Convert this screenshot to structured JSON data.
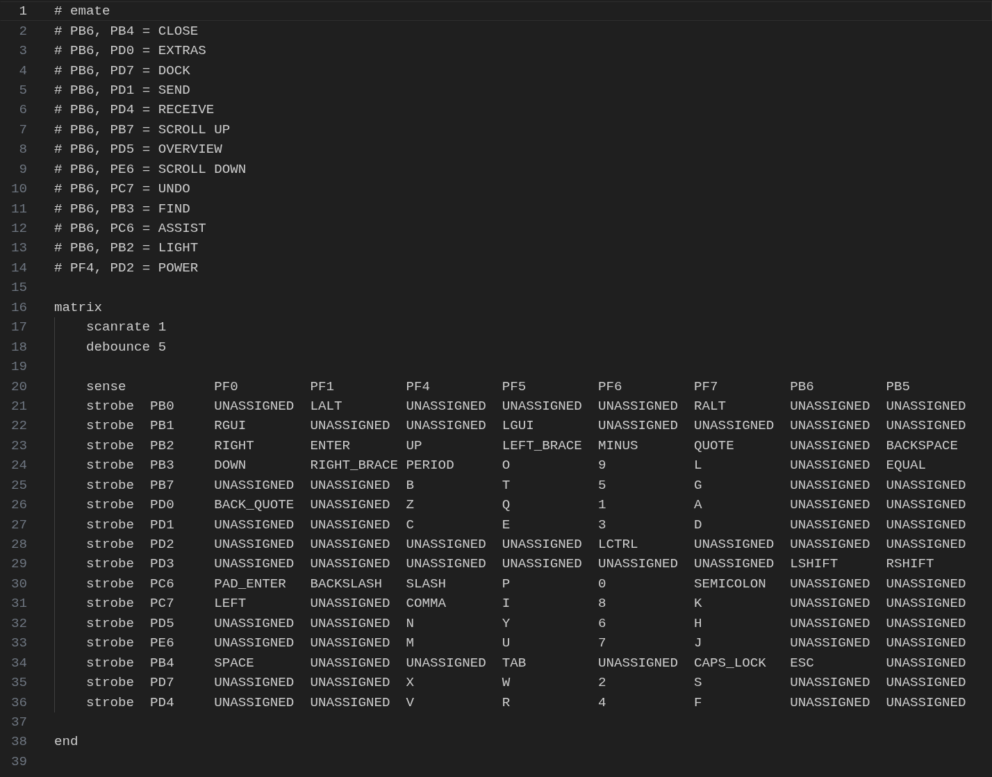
{
  "editor": {
    "lines": [
      {
        "number": "1",
        "text": "# emate",
        "current": true
      },
      {
        "number": "2",
        "text": "# PB6, PB4 = CLOSE",
        "current": false
      },
      {
        "number": "3",
        "text": "# PB6, PD0 = EXTRAS",
        "current": false
      },
      {
        "number": "4",
        "text": "# PB6, PD7 = DOCK",
        "current": false
      },
      {
        "number": "5",
        "text": "# PB6, PD1 = SEND",
        "current": false
      },
      {
        "number": "6",
        "text": "# PB6, PD4 = RECEIVE",
        "current": false
      },
      {
        "number": "7",
        "text": "# PB6, PB7 = SCROLL UP",
        "current": false
      },
      {
        "number": "8",
        "text": "# PB6, PD5 = OVERVIEW",
        "current": false
      },
      {
        "number": "9",
        "text": "# PB6, PE6 = SCROLL DOWN",
        "current": false
      },
      {
        "number": "10",
        "text": "# PB6, PC7 = UNDO",
        "current": false
      },
      {
        "number": "11",
        "text": "# PB6, PB3 = FIND",
        "current": false
      },
      {
        "number": "12",
        "text": "# PB6, PC6 = ASSIST",
        "current": false
      },
      {
        "number": "13",
        "text": "# PB6, PB2 = LIGHT",
        "current": false
      },
      {
        "number": "14",
        "text": "# PF4, PD2 = POWER",
        "current": false
      },
      {
        "number": "15",
        "current": false
      },
      {
        "number": "16",
        "text": "matrix",
        "current": false,
        "children": [
          {
            "number": "17",
            "text": "scanrate 1",
            "current": false
          },
          {
            "number": "18",
            "text": "debounce 5",
            "current": false
          },
          {
            "number": "19",
            "current": false
          },
          {
            "number": "20",
            "kind": "header",
            "cells": [
              "sense",
              "PF0",
              "PF1",
              "PF4",
              "PF5",
              "PF6",
              "PF7",
              "PB6",
              "PB5"
            ],
            "current": false
          },
          {
            "number": "21",
            "kind": "row",
            "cells": [
              "strobe",
              "PB0",
              "UNASSIGNED",
              "LALT",
              "UNASSIGNED",
              "UNASSIGNED",
              "UNASSIGNED",
              "RALT",
              "UNASSIGNED",
              "UNASSIGNED"
            ],
            "current": false
          },
          {
            "number": "22",
            "kind": "row",
            "cells": [
              "strobe",
              "PB1",
              "RGUI",
              "UNASSIGNED",
              "UNASSIGNED",
              "LGUI",
              "UNASSIGNED",
              "UNASSIGNED",
              "UNASSIGNED",
              "UNASSIGNED"
            ],
            "current": false
          },
          {
            "number": "23",
            "kind": "row",
            "cells": [
              "strobe",
              "PB2",
              "RIGHT",
              "ENTER",
              "UP",
              "LEFT_BRACE",
              "MINUS",
              "QUOTE",
              "UNASSIGNED",
              "BACKSPACE"
            ],
            "current": false
          },
          {
            "number": "24",
            "kind": "row",
            "cells": [
              "strobe",
              "PB3",
              "DOWN",
              "RIGHT_BRACE",
              "PERIOD",
              "O",
              "9",
              "L",
              "UNASSIGNED",
              "EQUAL"
            ],
            "current": false
          },
          {
            "number": "25",
            "kind": "row",
            "cells": [
              "strobe",
              "PB7",
              "UNASSIGNED",
              "UNASSIGNED",
              "B",
              "T",
              "5",
              "G",
              "UNASSIGNED",
              "UNASSIGNED"
            ],
            "current": false
          },
          {
            "number": "26",
            "kind": "row",
            "cells": [
              "strobe",
              "PD0",
              "BACK_QUOTE",
              "UNASSIGNED",
              "Z",
              "Q",
              "1",
              "A",
              "UNASSIGNED",
              "UNASSIGNED"
            ],
            "current": false
          },
          {
            "number": "27",
            "kind": "row",
            "cells": [
              "strobe",
              "PD1",
              "UNASSIGNED",
              "UNASSIGNED",
              "C",
              "E",
              "3",
              "D",
              "UNASSIGNED",
              "UNASSIGNED"
            ],
            "current": false
          },
          {
            "number": "28",
            "kind": "row",
            "cells": [
              "strobe",
              "PD2",
              "UNASSIGNED",
              "UNASSIGNED",
              "UNASSIGNED",
              "UNASSIGNED",
              "LCTRL",
              "UNASSIGNED",
              "UNASSIGNED",
              "UNASSIGNED"
            ],
            "current": false
          },
          {
            "number": "29",
            "kind": "row",
            "cells": [
              "strobe",
              "PD3",
              "UNASSIGNED",
              "UNASSIGNED",
              "UNASSIGNED",
              "UNASSIGNED",
              "UNASSIGNED",
              "UNASSIGNED",
              "LSHIFT",
              "RSHIFT"
            ],
            "current": false
          },
          {
            "number": "30",
            "kind": "row",
            "cells": [
              "strobe",
              "PC6",
              "PAD_ENTER",
              "BACKSLASH",
              "SLASH",
              "P",
              "0",
              "SEMICOLON",
              "UNASSIGNED",
              "UNASSIGNED"
            ],
            "current": false
          },
          {
            "number": "31",
            "kind": "row",
            "cells": [
              "strobe",
              "PC7",
              "LEFT",
              "UNASSIGNED",
              "COMMA",
              "I",
              "8",
              "K",
              "UNASSIGNED",
              "UNASSIGNED"
            ],
            "current": false
          },
          {
            "number": "32",
            "kind": "row",
            "cells": [
              "strobe",
              "PD5",
              "UNASSIGNED",
              "UNASSIGNED",
              "N",
              "Y",
              "6",
              "H",
              "UNASSIGNED",
              "UNASSIGNED"
            ],
            "current": false
          },
          {
            "number": "33",
            "kind": "row",
            "cells": [
              "strobe",
              "PE6",
              "UNASSIGNED",
              "UNASSIGNED",
              "M",
              "U",
              "7",
              "J",
              "UNASSIGNED",
              "UNASSIGNED"
            ],
            "current": false
          },
          {
            "number": "34",
            "kind": "row",
            "cells": [
              "strobe",
              "PB4",
              "SPACE",
              "UNASSIGNED",
              "UNASSIGNED",
              "TAB",
              "UNASSIGNED",
              "CAPS_LOCK",
              "ESC",
              "UNASSIGNED"
            ],
            "current": false
          },
          {
            "number": "35",
            "kind": "row",
            "cells": [
              "strobe",
              "PD7",
              "UNASSIGNED",
              "UNASSIGNED",
              "X",
              "W",
              "2",
              "S",
              "UNASSIGNED",
              "UNASSIGNED"
            ],
            "current": false
          },
          {
            "number": "36",
            "kind": "row",
            "cells": [
              "strobe",
              "PD4",
              "UNASSIGNED",
              "UNASSIGNED",
              "V",
              "R",
              "4",
              "F",
              "UNASSIGNED",
              "UNASSIGNED"
            ],
            "current": false
          }
        ]
      },
      {
        "number": "37",
        "current": false
      },
      {
        "number": "38",
        "text": "end",
        "current": false
      },
      {
        "number": "39",
        "current": false
      }
    ]
  }
}
